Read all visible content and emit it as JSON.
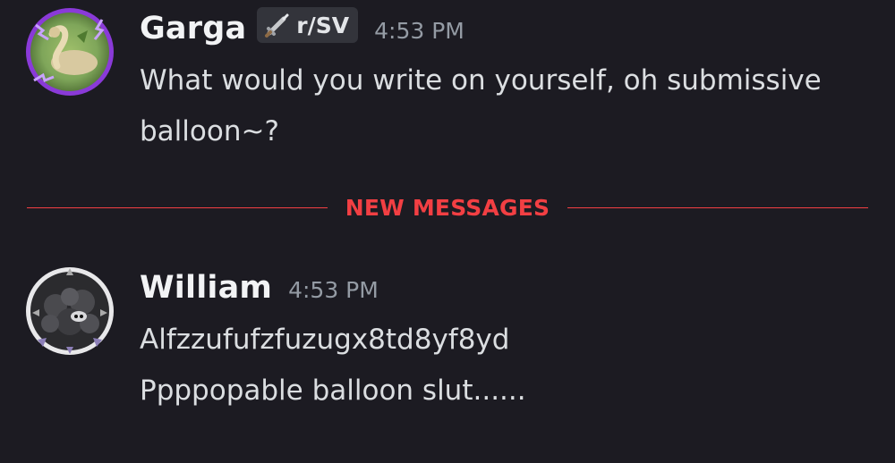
{
  "messages": [
    {
      "username": "Garga",
      "tag": {
        "icon": "sword-icon",
        "label": "r/SV"
      },
      "timestamp": "4:53 PM",
      "lines": [
        "What would you write on yourself, oh submissive",
        "balloon~?"
      ]
    },
    {
      "username": "William",
      "timestamp": "4:53 PM",
      "lines": [
        "Alfzzufufzfuzugx8td8yf8yd",
        "Ppppopable balloon slut......"
      ]
    }
  ],
  "divider": {
    "label": "NEW MESSAGES"
  },
  "colors": {
    "background": "#1c1b22",
    "new_messages": "#f23f43",
    "username": "#f2f3f5",
    "timestamp": "#949ba4",
    "text": "#dbdee1"
  }
}
